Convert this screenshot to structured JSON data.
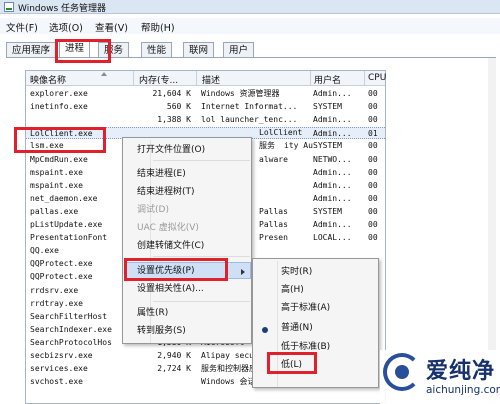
{
  "window": {
    "title": "Windows 任务管理器"
  },
  "menu": [
    "文件(F)",
    "选项(O)",
    "查看(V)",
    "帮助(H)"
  ],
  "tabs": [
    "应用程序",
    "进程",
    "服务",
    "性能",
    "联网",
    "用户"
  ],
  "columns": {
    "name": "映像名称",
    "mem": "内存(专...",
    "desc": "描述",
    "user": "用户名",
    "cpu": "CPU"
  },
  "rows": [
    {
      "name": "explorer.exe",
      "mem": "21,604 K",
      "desc": "Windows 资源管理器",
      "user": "Admin...",
      "cpu": "00"
    },
    {
      "name": "inetinfo.exe",
      "mem": "560 K",
      "desc": "Internet Informat...",
      "user": "SYSTEM",
      "cpu": "00"
    },
    {
      "name": "",
      "mem": "1,388 K",
      "desc": "lol launcher_tenc...",
      "user": "Admin...",
      "cpu": "00"
    },
    {
      "name": "LolClient.exe",
      "mem": "",
      "desc": "",
      "user": "Admin...",
      "cpu": "01"
    },
    {
      "name": "lsm.exe",
      "mem": "",
      "desc": "",
      "user": "SYSTEM",
      "cpu": "00"
    },
    {
      "name": "MpCmdRun.exe",
      "mem": "",
      "desc": "",
      "user": "NETWO...",
      "cpu": "00"
    },
    {
      "name": "mspaint.exe",
      "mem": "",
      "desc": "",
      "user": "Admin...",
      "cpu": "00"
    },
    {
      "name": "mspaint.exe",
      "mem": "",
      "desc": "",
      "user": "Admin...",
      "cpu": "00"
    },
    {
      "name": "net_daemon.exe",
      "mem": "",
      "desc": "",
      "user": "Admin...",
      "cpu": "00"
    },
    {
      "name": "pallas.exe",
      "mem": "",
      "desc": "",
      "user": "SYSTEM",
      "cpu": "00"
    },
    {
      "name": "pListUpdate.exe",
      "mem": "",
      "desc": "",
      "user": "Admin...",
      "cpu": "00"
    },
    {
      "name": "PresentationFont",
      "mem": "",
      "desc": "",
      "user": "LOCAL...",
      "cpu": "00"
    },
    {
      "name": "QQ.exe",
      "mem": "",
      "desc": "",
      "user": "",
      "cpu": ""
    },
    {
      "name": "QQProtect.exe",
      "mem": "",
      "desc": "",
      "user": "",
      "cpu": ""
    },
    {
      "name": "QQProtect.exe",
      "mem": "",
      "desc": "",
      "user": "",
      "cpu": ""
    },
    {
      "name": "rrdsrv.exe",
      "mem": "",
      "desc": "",
      "user": "",
      "cpu": ""
    },
    {
      "name": "rrdtray.exe",
      "mem": "",
      "desc": "",
      "user": "",
      "cpu": ""
    },
    {
      "name": "SearchFilterHost",
      "mem": "",
      "desc": "",
      "user": "",
      "cpu": ""
    },
    {
      "name": "SearchIndexer.exe",
      "mem": "10,324 K",
      "desc": "Microsoft",
      "user": "",
      "cpu": ""
    },
    {
      "name": "SearchProtocolHos",
      "mem": "1,580 K",
      "desc": "Microsoft",
      "user": "",
      "cpu": ""
    },
    {
      "name": "secbizsrv.exe",
      "mem": "2,940 K",
      "desc": "Alipay security b",
      "user": "",
      "cpu": ""
    },
    {
      "name": "services.exe",
      "mem": "2,724 K",
      "desc": "服务和控制器应用程序",
      "user": "",
      "cpu": ""
    },
    {
      "name": "svchost.exe",
      "mem": "",
      "desc": "Windows 会话管理器",
      "user": "",
      "cpu": ""
    }
  ],
  "partial_desc": [
    {
      "row": 3,
      "text": "LolClient"
    },
    {
      "row": 4,
      "text": "服务"
    },
    {
      "row": 5,
      "text": "alware"
    },
    {
      "row": 9,
      "text": "Pallas"
    },
    {
      "row": 10,
      "text": "Pallas"
    },
    {
      "row": 11,
      "text": "Presen"
    },
    {
      "row": 3,
      "text": "ity Au"
    }
  ],
  "context_menu": {
    "items": [
      {
        "label": "打开文件位置(O)",
        "disabled": false
      },
      {
        "label": "结束进程(E)",
        "disabled": false
      },
      {
        "label": "结束进程树(T)",
        "disabled": false
      },
      {
        "label": "调试(D)",
        "disabled": true
      },
      {
        "label": "UAC 虚拟化(V)",
        "disabled": true
      },
      {
        "label": "创建转储文件(C)",
        "disabled": false
      },
      {
        "label": "设置优先级(P)",
        "disabled": false
      },
      {
        "label": "设置相关性(A)...",
        "disabled": false
      },
      {
        "label": "属性(R)",
        "disabled": false
      },
      {
        "label": "转到服务(S)",
        "disabled": false
      }
    ]
  },
  "priority_menu": {
    "items": [
      "实时(R)",
      "高(H)",
      "高于标准(A)",
      "普通(N)",
      "低于标准(B)",
      "低(L)"
    ],
    "selected": "普通(N)"
  },
  "logo": {
    "text": "爱纯净",
    "url": "aichunjing.com"
  },
  "colors": {
    "highlight": "#e0202a",
    "menu_hover": "#cfe0f6",
    "brand": "#15316e"
  }
}
